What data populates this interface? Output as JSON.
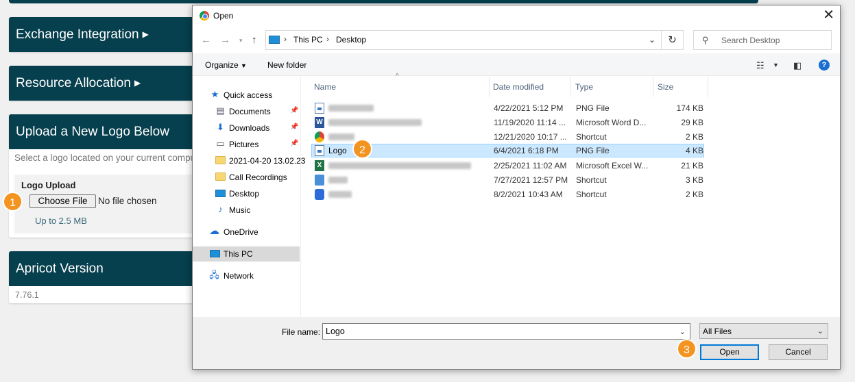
{
  "background": {
    "cards": {
      "exchange": "Exchange Integration",
      "resource": "Resource Allocation",
      "upload_title": "Upload a New Logo Below",
      "upload_desc": "Select a logo located on your current computer",
      "logo_upload_label": "Logo Upload",
      "choose_file": "Choose File",
      "no_file": "No file chosen",
      "size_limit": "Up to 2.5 MB",
      "version_title": "Apricot Version",
      "version": "7.76.1"
    }
  },
  "badges": [
    "1",
    "2",
    "3"
  ],
  "dialog": {
    "title": "Open",
    "address": {
      "segments": [
        "This PC",
        "Desktop"
      ]
    },
    "search_placeholder": "Search Desktop",
    "toolbar": {
      "organize": "Organize",
      "new_folder": "New folder"
    },
    "nav": [
      {
        "label": "Quick access"
      },
      {
        "label": "Documents"
      },
      {
        "label": "Downloads"
      },
      {
        "label": "Pictures"
      },
      {
        "label": "2021-04-20 13.02.23"
      },
      {
        "label": "Call Recordings"
      },
      {
        "label": "Desktop"
      },
      {
        "label": "Music"
      },
      {
        "label": "OneDrive"
      },
      {
        "label": "This PC"
      },
      {
        "label": "Network"
      }
    ],
    "columns": {
      "name": "Name",
      "date": "Date modified",
      "type": "Type",
      "size": "Size"
    },
    "files": [
      {
        "name": "",
        "date": "4/22/2021 5:12 PM",
        "type": "PNG File",
        "size": "174 KB"
      },
      {
        "name": "",
        "date": "11/19/2020 11:14 ...",
        "type": "Microsoft Word D...",
        "size": "29 KB"
      },
      {
        "name": "",
        "date": "12/21/2020 10:17 ...",
        "type": "Shortcut",
        "size": "2 KB"
      },
      {
        "name": "Logo",
        "date": "6/4/2021 6:18 PM",
        "type": "PNG File",
        "size": "4 KB"
      },
      {
        "name": "",
        "date": "2/25/2021 11:02 AM",
        "type": "Microsoft Excel W...",
        "size": "21 KB"
      },
      {
        "name": "",
        "date": "7/27/2021 12:57 PM",
        "type": "Shortcut",
        "size": "3 KB"
      },
      {
        "name": "",
        "date": "8/2/2021 10:43 AM",
        "type": "Shortcut",
        "size": "2 KB"
      }
    ],
    "file_name_label": "File name:",
    "file_name_value": "Logo",
    "file_type": "All Files",
    "open_button": "Open",
    "cancel_button": "Cancel"
  }
}
